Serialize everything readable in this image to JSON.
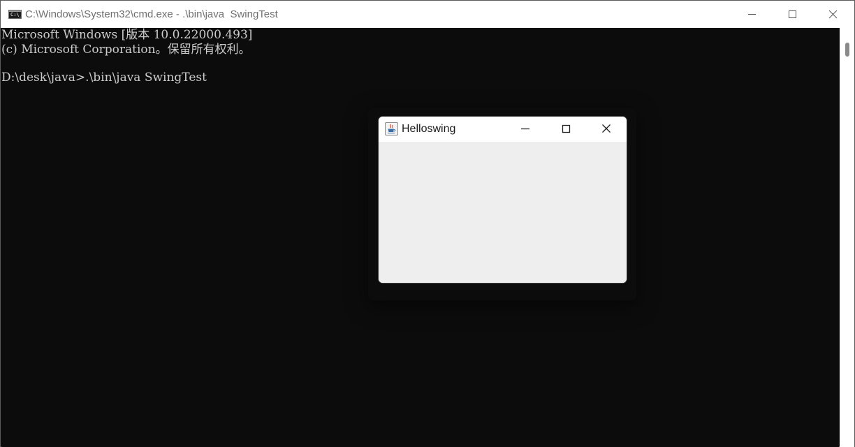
{
  "console_window": {
    "title": "C:\\Windows\\System32\\cmd.exe - .\\bin\\java  SwingTest",
    "icon": "cmd-icon",
    "icon_text": "C:\\_",
    "buttons": [
      "minimize-icon",
      "maximize-icon",
      "close-icon"
    ]
  },
  "console": {
    "lines": [
      "Microsoft Windows [版本 10.0.22000.493]",
      "(c) Microsoft Corporation。保留所有权利。",
      "",
      "D:\\desk\\java>.\\bin\\java SwingTest"
    ],
    "text_color": "#cccccc",
    "background": "#0c0c0c"
  },
  "swing_window": {
    "title": "Helloswing",
    "icon": "java-cup-icon",
    "buttons": [
      "minimize-icon",
      "maximize-icon",
      "close-icon"
    ],
    "content_background": "#eeeeee"
  }
}
